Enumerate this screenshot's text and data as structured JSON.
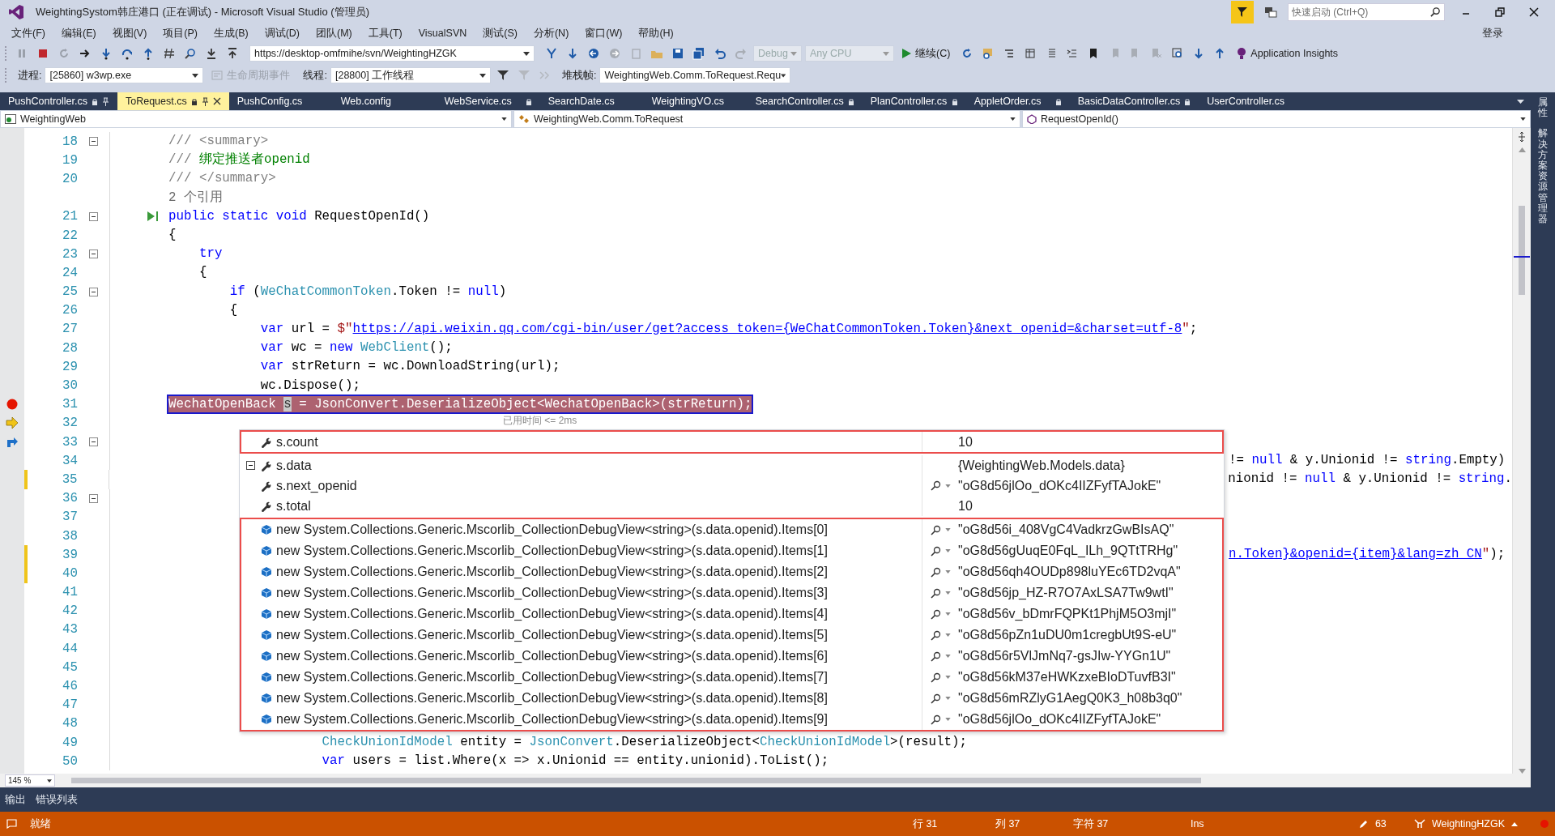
{
  "window": {
    "title": "WeightingSystom韩庄港口 (正在调试) - Microsoft Visual Studio (管理员)",
    "quick_launch": {
      "placeholder": "快速启动 (Ctrl+Q)"
    },
    "sign_in": "登录"
  },
  "menu": [
    "文件(F)",
    "编辑(E)",
    "视图(V)",
    "项目(P)",
    "生成(B)",
    "调试(D)",
    "团队(M)",
    "工具(T)",
    "VisualSVN",
    "测试(S)",
    "分析(N)",
    "窗口(W)",
    "帮助(H)"
  ],
  "toolbar": {
    "source_control_url": "https://desktop-omfmihe/svn/WeightingHZGK",
    "configuration": "Debug",
    "platform": "Any CPU",
    "continue": "继续(C)",
    "application_insights": "Application Insights"
  },
  "debug_location": {
    "process_label": "进程:",
    "process": "[25860] w3wp.exe",
    "lifecycle_events": "生命周期事件",
    "thread_label": "线程:",
    "thread": "[28800] 工作线程",
    "stack_frame_label": "堆栈帧:",
    "stack_frame": "WeightingWeb.Comm.ToRequest.Requ"
  },
  "tabs": [
    {
      "label": "PushController.cs",
      "selected": false,
      "locked": true,
      "pinned": true
    },
    {
      "label": "ToRequest.cs",
      "selected": true,
      "locked": true,
      "pinned": true
    },
    {
      "label": "PushConfig.cs",
      "selected": false,
      "locked": false,
      "pinned": false
    },
    {
      "label": "Web.config",
      "selected": false,
      "locked": false,
      "pinned": false
    },
    {
      "label": "WebService.cs",
      "selected": false,
      "locked": true,
      "pinned": false
    },
    {
      "label": "SearchDate.cs",
      "selected": false,
      "locked": false,
      "pinned": false
    },
    {
      "label": "WeightingVO.cs",
      "selected": false,
      "locked": false,
      "pinned": false
    },
    {
      "label": "SearchController.cs",
      "selected": false,
      "locked": true,
      "pinned": false
    },
    {
      "label": "PlanController.cs",
      "selected": false,
      "locked": true,
      "pinned": false
    },
    {
      "label": "AppletOrder.cs",
      "selected": false,
      "locked": true,
      "pinned": false
    },
    {
      "label": "BasicDataController.cs",
      "selected": false,
      "locked": true,
      "pinned": false
    },
    {
      "label": "UserController.cs",
      "selected": false,
      "locked": false,
      "pinned": false
    }
  ],
  "navigation": {
    "project": "WeightingWeb",
    "type": "WeightingWeb.Comm.ToRequest",
    "member": "RequestOpenId()"
  },
  "editor": {
    "zoom": "145 %",
    "lines": [
      {
        "num": "18",
        "fold": true,
        "changed": false,
        "tokens": [
          {
            "kind": "doc",
            "t": "/// <summary>"
          }
        ]
      },
      {
        "num": "19",
        "fold": false,
        "changed": false,
        "tokens": [
          {
            "kind": "doc",
            "t": "/// "
          },
          {
            "kind": "comment",
            "t": "绑定推送者openid"
          }
        ]
      },
      {
        "num": "20",
        "fold": false,
        "changed": false,
        "tokens": [
          {
            "kind": "doc",
            "t": "/// </summary>"
          }
        ]
      },
      {
        "kind": "codelens",
        "fold": false,
        "changed": false,
        "tokens": [
          {
            "kind": "lens",
            "t": "2 个引用"
          }
        ]
      },
      {
        "num": "21",
        "fold": true,
        "changed": false,
        "glyph": {
          "kind": "run"
        },
        "tokens": [
          {
            "kind": "kw",
            "t": "public static void "
          },
          {
            "kind": "plain",
            "t": "RequestOpenId()"
          }
        ]
      },
      {
        "num": "22",
        "fold": false,
        "changed": false,
        "tokens": [
          {
            "kind": "plain",
            "t": "{"
          }
        ]
      },
      {
        "num": "23",
        "fold": true,
        "changed": false,
        "tokens": [
          {
            "kind": "kw",
            "t": "    try"
          }
        ]
      },
      {
        "num": "24",
        "fold": false,
        "changed": false,
        "tokens": [
          {
            "kind": "plain",
            "t": "    {"
          }
        ]
      },
      {
        "num": "25",
        "fold": true,
        "changed": false,
        "tokens": [
          {
            "kind": "kw",
            "t": "        if"
          },
          {
            "kind": "plain",
            "t": " ("
          },
          {
            "kind": "type",
            "t": "WeChatCommonToken"
          },
          {
            "kind": "plain",
            "t": ".Token != "
          },
          {
            "kind": "kw",
            "t": "null"
          },
          {
            "kind": "plain",
            "t": ")"
          }
        ]
      },
      {
        "num": "26",
        "fold": false,
        "changed": false,
        "tokens": [
          {
            "kind": "plain",
            "t": "        {"
          }
        ]
      },
      {
        "num": "27",
        "fold": false,
        "changed": false,
        "tokens": [
          {
            "kind": "kw",
            "t": "            var"
          },
          {
            "kind": "plain",
            "t": " url = "
          },
          {
            "kind": "str",
            "t": "$\""
          },
          {
            "kind": "url",
            "t": "https://api.weixin.qq.com/cgi-bin/user/get?access_token={WeChatCommonToken.Token}&next_openid=&charset=utf-8"
          },
          {
            "kind": "str",
            "t": "\""
          },
          {
            "kind": "plain",
            "t": ";"
          }
        ]
      },
      {
        "num": "28",
        "fold": false,
        "changed": false,
        "tokens": [
          {
            "kind": "kw",
            "t": "            var"
          },
          {
            "kind": "plain",
            "t": " wc = "
          },
          {
            "kind": "kw",
            "t": "new"
          },
          {
            "kind": "type",
            "t": " WebClient"
          },
          {
            "kind": "plain",
            "t": "();"
          }
        ]
      },
      {
        "num": "29",
        "fold": false,
        "changed": false,
        "tokens": [
          {
            "kind": "kw",
            "t": "            var"
          },
          {
            "kind": "plain",
            "t": " strReturn = wc.DownloadString(url);"
          }
        ]
      },
      {
        "num": "30",
        "fold": false,
        "changed": false,
        "tokens": [
          {
            "kind": "plain",
            "t": "            wc.Dispose();"
          }
        ]
      },
      {
        "num": "31",
        "fold": false,
        "changed": false,
        "glyph": {
          "kind": "breakpoint"
        },
        "highlight": true,
        "tokens": [
          {
            "kind": "hl",
            "t": "WechatOpenBack "
          },
          {
            "kind": "caret",
            "t": "s"
          },
          {
            "kind": "hl",
            "t": " = JsonConvert.DeserializeObject<WechatOpenBack>(strReturn);"
          }
        ]
      },
      {
        "num": "32",
        "fold": false,
        "changed": false,
        "glyph": {
          "kind": "execution"
        },
        "kind": "perftip",
        "tokens": [
          {
            "kind": "perf",
            "t": "已用时间 <= 2ms"
          }
        ]
      },
      {
        "num": "33",
        "fold": true,
        "changed": false,
        "glyph": {
          "kind": "return"
        }
      },
      {
        "num": "34",
        "fold": false,
        "changed": false,
        "kind": "tail",
        "tokens": [
          {
            "kind": "plain",
            "t": "!= "
          },
          {
            "kind": "kw",
            "t": "null"
          },
          {
            "kind": "plain",
            "t": " & y.Unionid != "
          },
          {
            "kind": "kw",
            "t": "string"
          },
          {
            "kind": "plain",
            "t": ".Empty)"
          }
        ]
      },
      {
        "num": "35",
        "fold": false,
        "changed": true,
        "kind": "tail",
        "tokens": [
          {
            "kind": "plain",
            "t": "nionid != "
          },
          {
            "kind": "kw",
            "t": "null"
          },
          {
            "kind": "plain",
            "t": " & y.Unionid != "
          },
          {
            "kind": "kw",
            "t": "string"
          },
          {
            "kind": "plain",
            "t": "."
          }
        ]
      },
      {
        "num": "36",
        "fold": true,
        "changed": false
      },
      {
        "num": "37",
        "fold": false,
        "changed": false
      },
      {
        "num": "38",
        "fold": false,
        "changed": false
      },
      {
        "num": "39",
        "fold": false,
        "changed": true,
        "kind": "tail",
        "tokens": [
          {
            "kind": "url",
            "t": "n.Token}&openid={item}&lang=zh_CN"
          },
          {
            "kind": "str",
            "t": "\""
          },
          {
            "kind": "plain",
            "t": ");"
          }
        ]
      },
      {
        "num": "40",
        "fold": false,
        "changed": true
      },
      {
        "num": "41",
        "fold": false,
        "changed": false
      },
      {
        "num": "42",
        "fold": false,
        "changed": false
      },
      {
        "num": "43",
        "fold": false,
        "changed": false
      },
      {
        "num": "44",
        "fold": false,
        "changed": false
      },
      {
        "num": "45",
        "fold": false,
        "changed": false
      },
      {
        "num": "46",
        "fold": false,
        "changed": false
      },
      {
        "num": "47",
        "fold": false,
        "changed": false
      },
      {
        "num": "48",
        "fold": false,
        "changed": false
      },
      {
        "num": "49",
        "fold": false,
        "changed": false,
        "tokens": [
          {
            "kind": "type",
            "t": "                    CheckUnionIdModel"
          },
          {
            "kind": "plain",
            "t": " entity = "
          },
          {
            "kind": "type",
            "t": "JsonConvert"
          },
          {
            "kind": "plain",
            "t": ".DeserializeObject<"
          },
          {
            "kind": "type",
            "t": "CheckUnionIdModel"
          },
          {
            "kind": "plain",
            "t": ">(result);"
          }
        ]
      },
      {
        "num": "50",
        "fold": false,
        "changed": false,
        "tokens": [
          {
            "kind": "kw",
            "t": "                    var"
          },
          {
            "kind": "plain",
            "t": " users = list.Where(x => x.Unionid == entity.unionid).ToList();"
          }
        ]
      }
    ]
  },
  "datatip": {
    "groups": [
      {
        "highlighted": true,
        "rows": [
          {
            "name": "s.count",
            "value": "10",
            "kind": "property",
            "visualizer": false
          }
        ]
      },
      {
        "highlighted": false,
        "rows": [
          {
            "name": "s.data",
            "value": "{WeightingWeb.Models.data}",
            "kind": "object",
            "expanded": true,
            "visualizer": false
          },
          {
            "name": "s.next_openid",
            "value": "\"oG8d56jlOo_dOKc4IIZFyfTAJokE\"",
            "kind": "property",
            "visualizer": true
          },
          {
            "name": "s.total",
            "value": "10",
            "kind": "property",
            "visualizer": false
          }
        ]
      },
      {
        "highlighted": true,
        "rows": [
          {
            "name": "new System.Collections.Generic.Mscorlib_CollectionDebugView<string>(s.data.openid).Items[0]",
            "value": "\"oG8d56i_408VgC4VadkrzGwBIsAQ\"",
            "kind": "item",
            "visualizer": true
          },
          {
            "name": "new System.Collections.Generic.Mscorlib_CollectionDebugView<string>(s.data.openid).Items[1]",
            "value": "\"oG8d56gUuqE0FqL_ILh_9QTtTRHg\"",
            "kind": "item",
            "visualizer": true
          },
          {
            "name": "new System.Collections.Generic.Mscorlib_CollectionDebugView<string>(s.data.openid).Items[2]",
            "value": "\"oG8d56qh4OUDp898luYEc6TD2vqA\"",
            "kind": "item",
            "visualizer": true
          },
          {
            "name": "new System.Collections.Generic.Mscorlib_CollectionDebugView<string>(s.data.openid).Items[3]",
            "value": "\"oG8d56jp_HZ-R7O7AxLSA7Tw9wtI\"",
            "kind": "item",
            "visualizer": true
          },
          {
            "name": "new System.Collections.Generic.Mscorlib_CollectionDebugView<string>(s.data.openid).Items[4]",
            "value": "\"oG8d56v_bDmrFQPKt1PhjM5O3mjI\"",
            "kind": "item",
            "visualizer": true
          },
          {
            "name": "new System.Collections.Generic.Mscorlib_CollectionDebugView<string>(s.data.openid).Items[5]",
            "value": "\"oG8d56pZn1uDU0m1cregbUt9S-eU\"",
            "kind": "item",
            "visualizer": true
          },
          {
            "name": "new System.Collections.Generic.Mscorlib_CollectionDebugView<string>(s.data.openid).Items[6]",
            "value": "\"oG8d56r5VlJmNq7-gsJIw-YYGn1U\"",
            "kind": "item",
            "visualizer": true
          },
          {
            "name": "new System.Collections.Generic.Mscorlib_CollectionDebugView<string>(s.data.openid).Items[7]",
            "value": "\"oG8d56kM37eHWKzxeBIoDTuvfB3I\"",
            "kind": "item",
            "visualizer": true
          },
          {
            "name": "new System.Collections.Generic.Mscorlib_CollectionDebugView<string>(s.data.openid).Items[8]",
            "value": "\"oG8d56mRZlyG1AegQ0K3_h08b3q0\"",
            "kind": "item",
            "visualizer": true
          },
          {
            "name": "new System.Collections.Generic.Mscorlib_CollectionDebugView<string>(s.data.openid).Items[9]",
            "value": "\"oG8d56jlOo_dOKc4IIZFyfTAJokE\"",
            "kind": "item",
            "visualizer": true
          }
        ]
      }
    ]
  },
  "side_tabs": [
    "属性",
    "解决方案资源管理器"
  ],
  "bottom_tabs": [
    {
      "label": "输出",
      "selected": false
    },
    {
      "label": "错误列表",
      "selected": false
    }
  ],
  "status_bar": {
    "message": "就绪",
    "line": "行 31",
    "column": "列 37",
    "char": "字符 37",
    "mode": "Ins",
    "pending_changes": "63",
    "repository": "WeightingHZGK"
  }
}
